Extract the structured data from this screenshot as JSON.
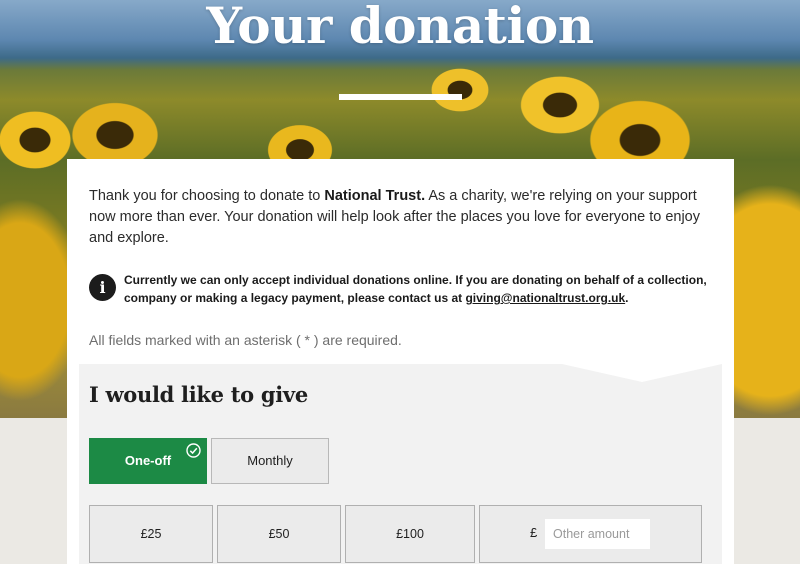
{
  "hero": {
    "title": "Your donation"
  },
  "intro": {
    "before": "Thank you for choosing to donate to ",
    "org": "National Trust.",
    "after": " As a charity, we're relying on your support now more than ever. Your donation will help look after the places you love for everyone to enjoy and explore."
  },
  "notice": {
    "icon": "info-icon",
    "text": "Currently we can only accept individual donations online. If you are donating on behalf of a collection, company or making a legacy payment, please contact us at ",
    "email": "giving@nationaltrust.org.uk",
    "end": "."
  },
  "required_note": "All fields marked with an asterisk ( * ) are required.",
  "give": {
    "title": "I would like to give",
    "frequency": [
      {
        "label": "One-off",
        "selected": true
      },
      {
        "label": "Monthly",
        "selected": false
      }
    ],
    "amounts": [
      "£25",
      "£50",
      "£100"
    ],
    "other": {
      "currency": "£",
      "placeholder": "Other amount",
      "value": ""
    }
  },
  "colors": {
    "accent_green": "#1c8a45",
    "panel": "#f2f2f2"
  }
}
